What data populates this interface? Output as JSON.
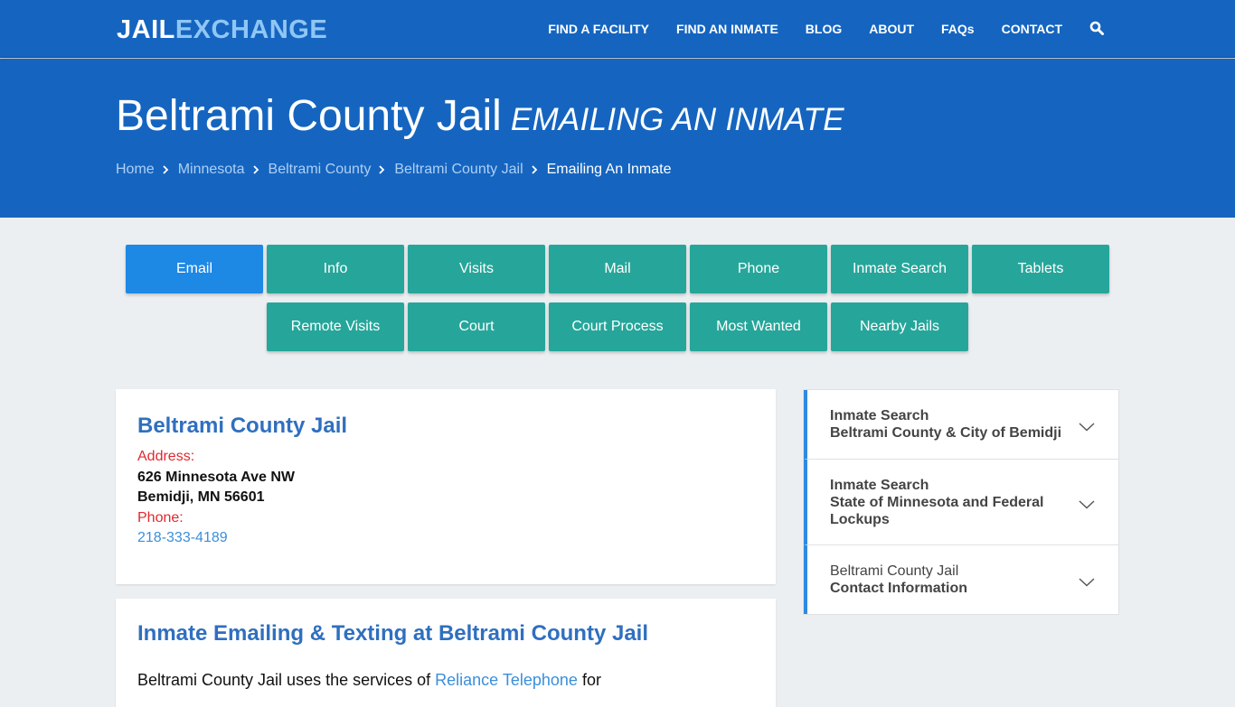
{
  "brand": {
    "part1": "JAIL",
    "part2": "EXCHANGE"
  },
  "nav": {
    "links": [
      "FIND A FACILITY",
      "FIND AN INMATE",
      "BLOG",
      "ABOUT",
      "FAQs",
      "CONTACT"
    ],
    "search_icon": "search-icon"
  },
  "hero": {
    "title": "Beltrami County Jail",
    "subtitle": "EMAILING AN INMATE",
    "breadcrumb": [
      "Home",
      "Minnesota",
      "Beltrami County",
      "Beltrami County Jail",
      "Emailing An Inmate"
    ]
  },
  "tabs": {
    "row1": [
      "Email",
      "Info",
      "Visits",
      "Mail",
      "Phone",
      "Inmate Search",
      "Tablets"
    ],
    "row2": [
      "Remote Visits",
      "Court",
      "Court Process",
      "Most Wanted",
      "Nearby Jails"
    ],
    "active": "Email"
  },
  "facility_card": {
    "title": "Beltrami County Jail",
    "address_label": "Address:",
    "address_line1": "626 Minnesota Ave NW",
    "address_line2": "Bemidji, MN 56601",
    "phone_label": "Phone:",
    "phone": "218-333-4189"
  },
  "email_card": {
    "title": "Inmate Emailing & Texting at Beltrami County Jail",
    "text_before": "Beltrami County Jail uses the services of ",
    "link": "Reliance Telephone",
    "text_after": " for"
  },
  "sidebar": {
    "items": [
      {
        "line1": "Inmate Search",
        "line2": "Beltrami County & City of Bemidji",
        "line3": ""
      },
      {
        "line1": "Inmate Search",
        "line2": "State of Minnesota and Federal",
        "line3": "Lockups"
      },
      {
        "line1": "Beltrami County Jail",
        "line2": "Contact Information",
        "line3": ""
      }
    ]
  },
  "colors": {
    "header_blue": "#1565c0",
    "tab_teal": "#26a69a",
    "tab_active": "#1e88e5",
    "link_blue": "#3b8fdb",
    "label_red": "#e0292e"
  }
}
